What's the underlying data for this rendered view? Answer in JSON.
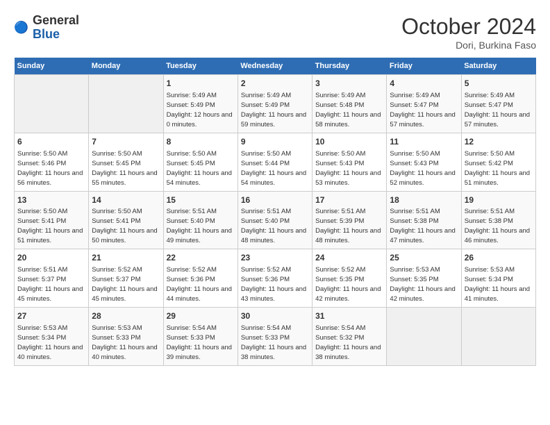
{
  "logo": {
    "general": "General",
    "blue": "Blue"
  },
  "header": {
    "month": "October 2024",
    "location": "Dori, Burkina Faso"
  },
  "weekdays": [
    "Sunday",
    "Monday",
    "Tuesday",
    "Wednesday",
    "Thursday",
    "Friday",
    "Saturday"
  ],
  "weeks": [
    [
      {
        "day": "",
        "info": ""
      },
      {
        "day": "",
        "info": ""
      },
      {
        "day": "1",
        "sunrise": "5:49 AM",
        "sunset": "5:49 PM",
        "daylight": "12 hours and 0 minutes."
      },
      {
        "day": "2",
        "sunrise": "5:49 AM",
        "sunset": "5:49 PM",
        "daylight": "11 hours and 59 minutes."
      },
      {
        "day": "3",
        "sunrise": "5:49 AM",
        "sunset": "5:48 PM",
        "daylight": "11 hours and 58 minutes."
      },
      {
        "day": "4",
        "sunrise": "5:49 AM",
        "sunset": "5:47 PM",
        "daylight": "11 hours and 57 minutes."
      },
      {
        "day": "5",
        "sunrise": "5:49 AM",
        "sunset": "5:47 PM",
        "daylight": "11 hours and 57 minutes."
      }
    ],
    [
      {
        "day": "6",
        "sunrise": "5:50 AM",
        "sunset": "5:46 PM",
        "daylight": "11 hours and 56 minutes."
      },
      {
        "day": "7",
        "sunrise": "5:50 AM",
        "sunset": "5:45 PM",
        "daylight": "11 hours and 55 minutes."
      },
      {
        "day": "8",
        "sunrise": "5:50 AM",
        "sunset": "5:45 PM",
        "daylight": "11 hours and 54 minutes."
      },
      {
        "day": "9",
        "sunrise": "5:50 AM",
        "sunset": "5:44 PM",
        "daylight": "11 hours and 54 minutes."
      },
      {
        "day": "10",
        "sunrise": "5:50 AM",
        "sunset": "5:43 PM",
        "daylight": "11 hours and 53 minutes."
      },
      {
        "day": "11",
        "sunrise": "5:50 AM",
        "sunset": "5:43 PM",
        "daylight": "11 hours and 52 minutes."
      },
      {
        "day": "12",
        "sunrise": "5:50 AM",
        "sunset": "5:42 PM",
        "daylight": "11 hours and 51 minutes."
      }
    ],
    [
      {
        "day": "13",
        "sunrise": "5:50 AM",
        "sunset": "5:41 PM",
        "daylight": "11 hours and 51 minutes."
      },
      {
        "day": "14",
        "sunrise": "5:50 AM",
        "sunset": "5:41 PM",
        "daylight": "11 hours and 50 minutes."
      },
      {
        "day": "15",
        "sunrise": "5:51 AM",
        "sunset": "5:40 PM",
        "daylight": "11 hours and 49 minutes."
      },
      {
        "day": "16",
        "sunrise": "5:51 AM",
        "sunset": "5:40 PM",
        "daylight": "11 hours and 48 minutes."
      },
      {
        "day": "17",
        "sunrise": "5:51 AM",
        "sunset": "5:39 PM",
        "daylight": "11 hours and 48 minutes."
      },
      {
        "day": "18",
        "sunrise": "5:51 AM",
        "sunset": "5:38 PM",
        "daylight": "11 hours and 47 minutes."
      },
      {
        "day": "19",
        "sunrise": "5:51 AM",
        "sunset": "5:38 PM",
        "daylight": "11 hours and 46 minutes."
      }
    ],
    [
      {
        "day": "20",
        "sunrise": "5:51 AM",
        "sunset": "5:37 PM",
        "daylight": "11 hours and 45 minutes."
      },
      {
        "day": "21",
        "sunrise": "5:52 AM",
        "sunset": "5:37 PM",
        "daylight": "11 hours and 45 minutes."
      },
      {
        "day": "22",
        "sunrise": "5:52 AM",
        "sunset": "5:36 PM",
        "daylight": "11 hours and 44 minutes."
      },
      {
        "day": "23",
        "sunrise": "5:52 AM",
        "sunset": "5:36 PM",
        "daylight": "11 hours and 43 minutes."
      },
      {
        "day": "24",
        "sunrise": "5:52 AM",
        "sunset": "5:35 PM",
        "daylight": "11 hours and 42 minutes."
      },
      {
        "day": "25",
        "sunrise": "5:53 AM",
        "sunset": "5:35 PM",
        "daylight": "11 hours and 42 minutes."
      },
      {
        "day": "26",
        "sunrise": "5:53 AM",
        "sunset": "5:34 PM",
        "daylight": "11 hours and 41 minutes."
      }
    ],
    [
      {
        "day": "27",
        "sunrise": "5:53 AM",
        "sunset": "5:34 PM",
        "daylight": "11 hours and 40 minutes."
      },
      {
        "day": "28",
        "sunrise": "5:53 AM",
        "sunset": "5:33 PM",
        "daylight": "11 hours and 40 minutes."
      },
      {
        "day": "29",
        "sunrise": "5:54 AM",
        "sunset": "5:33 PM",
        "daylight": "11 hours and 39 minutes."
      },
      {
        "day": "30",
        "sunrise": "5:54 AM",
        "sunset": "5:33 PM",
        "daylight": "11 hours and 38 minutes."
      },
      {
        "day": "31",
        "sunrise": "5:54 AM",
        "sunset": "5:32 PM",
        "daylight": "11 hours and 38 minutes."
      },
      {
        "day": "",
        "info": ""
      },
      {
        "day": "",
        "info": ""
      }
    ]
  ],
  "labels": {
    "sunrise": "Sunrise:",
    "sunset": "Sunset:",
    "daylight": "Daylight:"
  }
}
